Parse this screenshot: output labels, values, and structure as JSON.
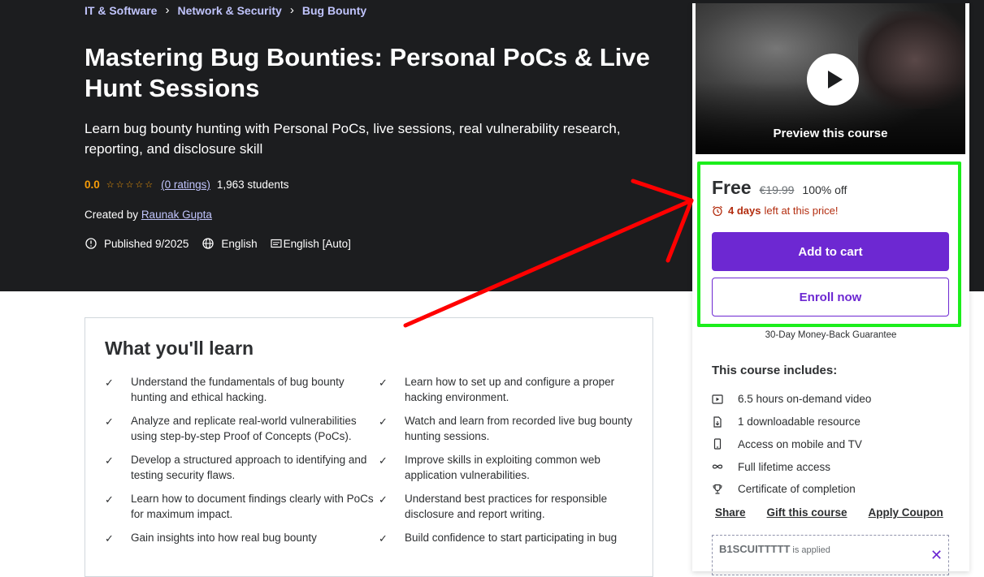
{
  "breadcrumb": [
    "IT & Software",
    "Network & Security",
    "Bug Bounty"
  ],
  "course": {
    "title": "Mastering Bug Bounties: Personal PoCs & Live Hunt Sessions",
    "subtitle": "Learn bug bounty hunting with Personal PoCs, live sessions, real vulnerability research, reporting, and disclosure skill",
    "rating": "0.0",
    "ratings_link": "(0 ratings)",
    "students": "1,963 students",
    "created_by_label": "Created by",
    "author": "Raunak Gupta",
    "published": "Published 9/2025",
    "language": "English",
    "captions": "English [Auto]"
  },
  "learn": {
    "title": "What you'll learn",
    "items": [
      "Understand the fundamentals of bug bounty hunting and ethical hacking.",
      "Learn how to set up and configure a proper hacking environment.",
      "Analyze and replicate real-world vulnerabilities using step-by-step Proof of Concepts (PoCs).",
      "Watch and learn from recorded live bug bounty hunting sessions.",
      "Develop a structured approach to identifying and testing security flaws.",
      "Improve skills in exploiting common web application vulnerabilities.",
      "Learn how to document findings clearly with PoCs for maximum impact.",
      "Understand best practices for responsible disclosure and report writing.",
      "Gain insights into how real bug bounty",
      "Build confidence to start participating in bug"
    ]
  },
  "sidebar": {
    "preview_label": "Preview this course",
    "price": "Free",
    "original_price": "€19.99",
    "discount": "100% off",
    "timer_bold": "4 days",
    "timer_rest": "left at this price!",
    "add_to_cart": "Add to cart",
    "enroll_now": "Enroll now",
    "guarantee": "30-Day Money-Back Guarantee",
    "includes_title": "This course includes:",
    "includes": [
      {
        "icon": "video-icon",
        "text": "6.5 hours on-demand video"
      },
      {
        "icon": "file-download-icon",
        "text": "1 downloadable resource"
      },
      {
        "icon": "mobile-icon",
        "text": "Access on mobile and TV"
      },
      {
        "icon": "infinity-icon",
        "text": "Full lifetime access"
      },
      {
        "icon": "trophy-icon",
        "text": "Certificate of completion"
      }
    ],
    "share": "Share",
    "gift": "Gift this course",
    "apply_coupon": "Apply Coupon",
    "coupon_code": "B1SCUITTTTT",
    "coupon_applied": "is applied"
  },
  "colors": {
    "hero_bg": "#1c1d1f",
    "accent_purple": "#6d28d2",
    "link_lavender": "#c0c4fc",
    "star_orange": "#f69c08",
    "timer_red": "#b32d0f",
    "highlight_green": "#1bee1b",
    "annotation_red": "#ff0000"
  }
}
